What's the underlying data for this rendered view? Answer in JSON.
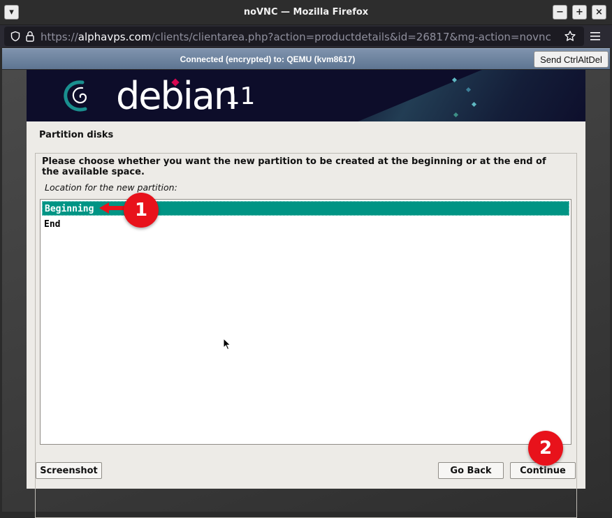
{
  "window": {
    "title": "noVNC — Mozilla Firefox",
    "menu_glyph": "▾",
    "minimize_glyph": "−",
    "maximize_glyph": "+",
    "close_glyph": "×"
  },
  "browser": {
    "url_prefix": "https://",
    "url_host": "alphavps.com",
    "url_path": "/clients/clientarea.php?action=productdetails&id=26817&mg-action=novnc"
  },
  "vnc": {
    "status": "Connected (encrypted) to: QEMU (kvm8617)",
    "ctrl_alt_del_label": "Send CtrlAltDel"
  },
  "installer": {
    "brand": "debian",
    "version": "11",
    "section_title": "Partition disks",
    "question": "Please choose whether you want the new partition to be created at the beginning or at the end of the available space.",
    "location_label": "Location for the new partition:",
    "options": [
      {
        "label": "Beginning",
        "selected": true
      },
      {
        "label": "End",
        "selected": false
      }
    ],
    "screenshot_label": "Screenshot",
    "go_back_label": "Go Back",
    "continue_label": "Continue"
  },
  "annotations": {
    "step1": "1",
    "step2": "2",
    "accent_color": "#e8121b"
  },
  "colors": {
    "selection": "#009484",
    "banner": "#0d0d2a",
    "debian_red": "#d70751"
  }
}
